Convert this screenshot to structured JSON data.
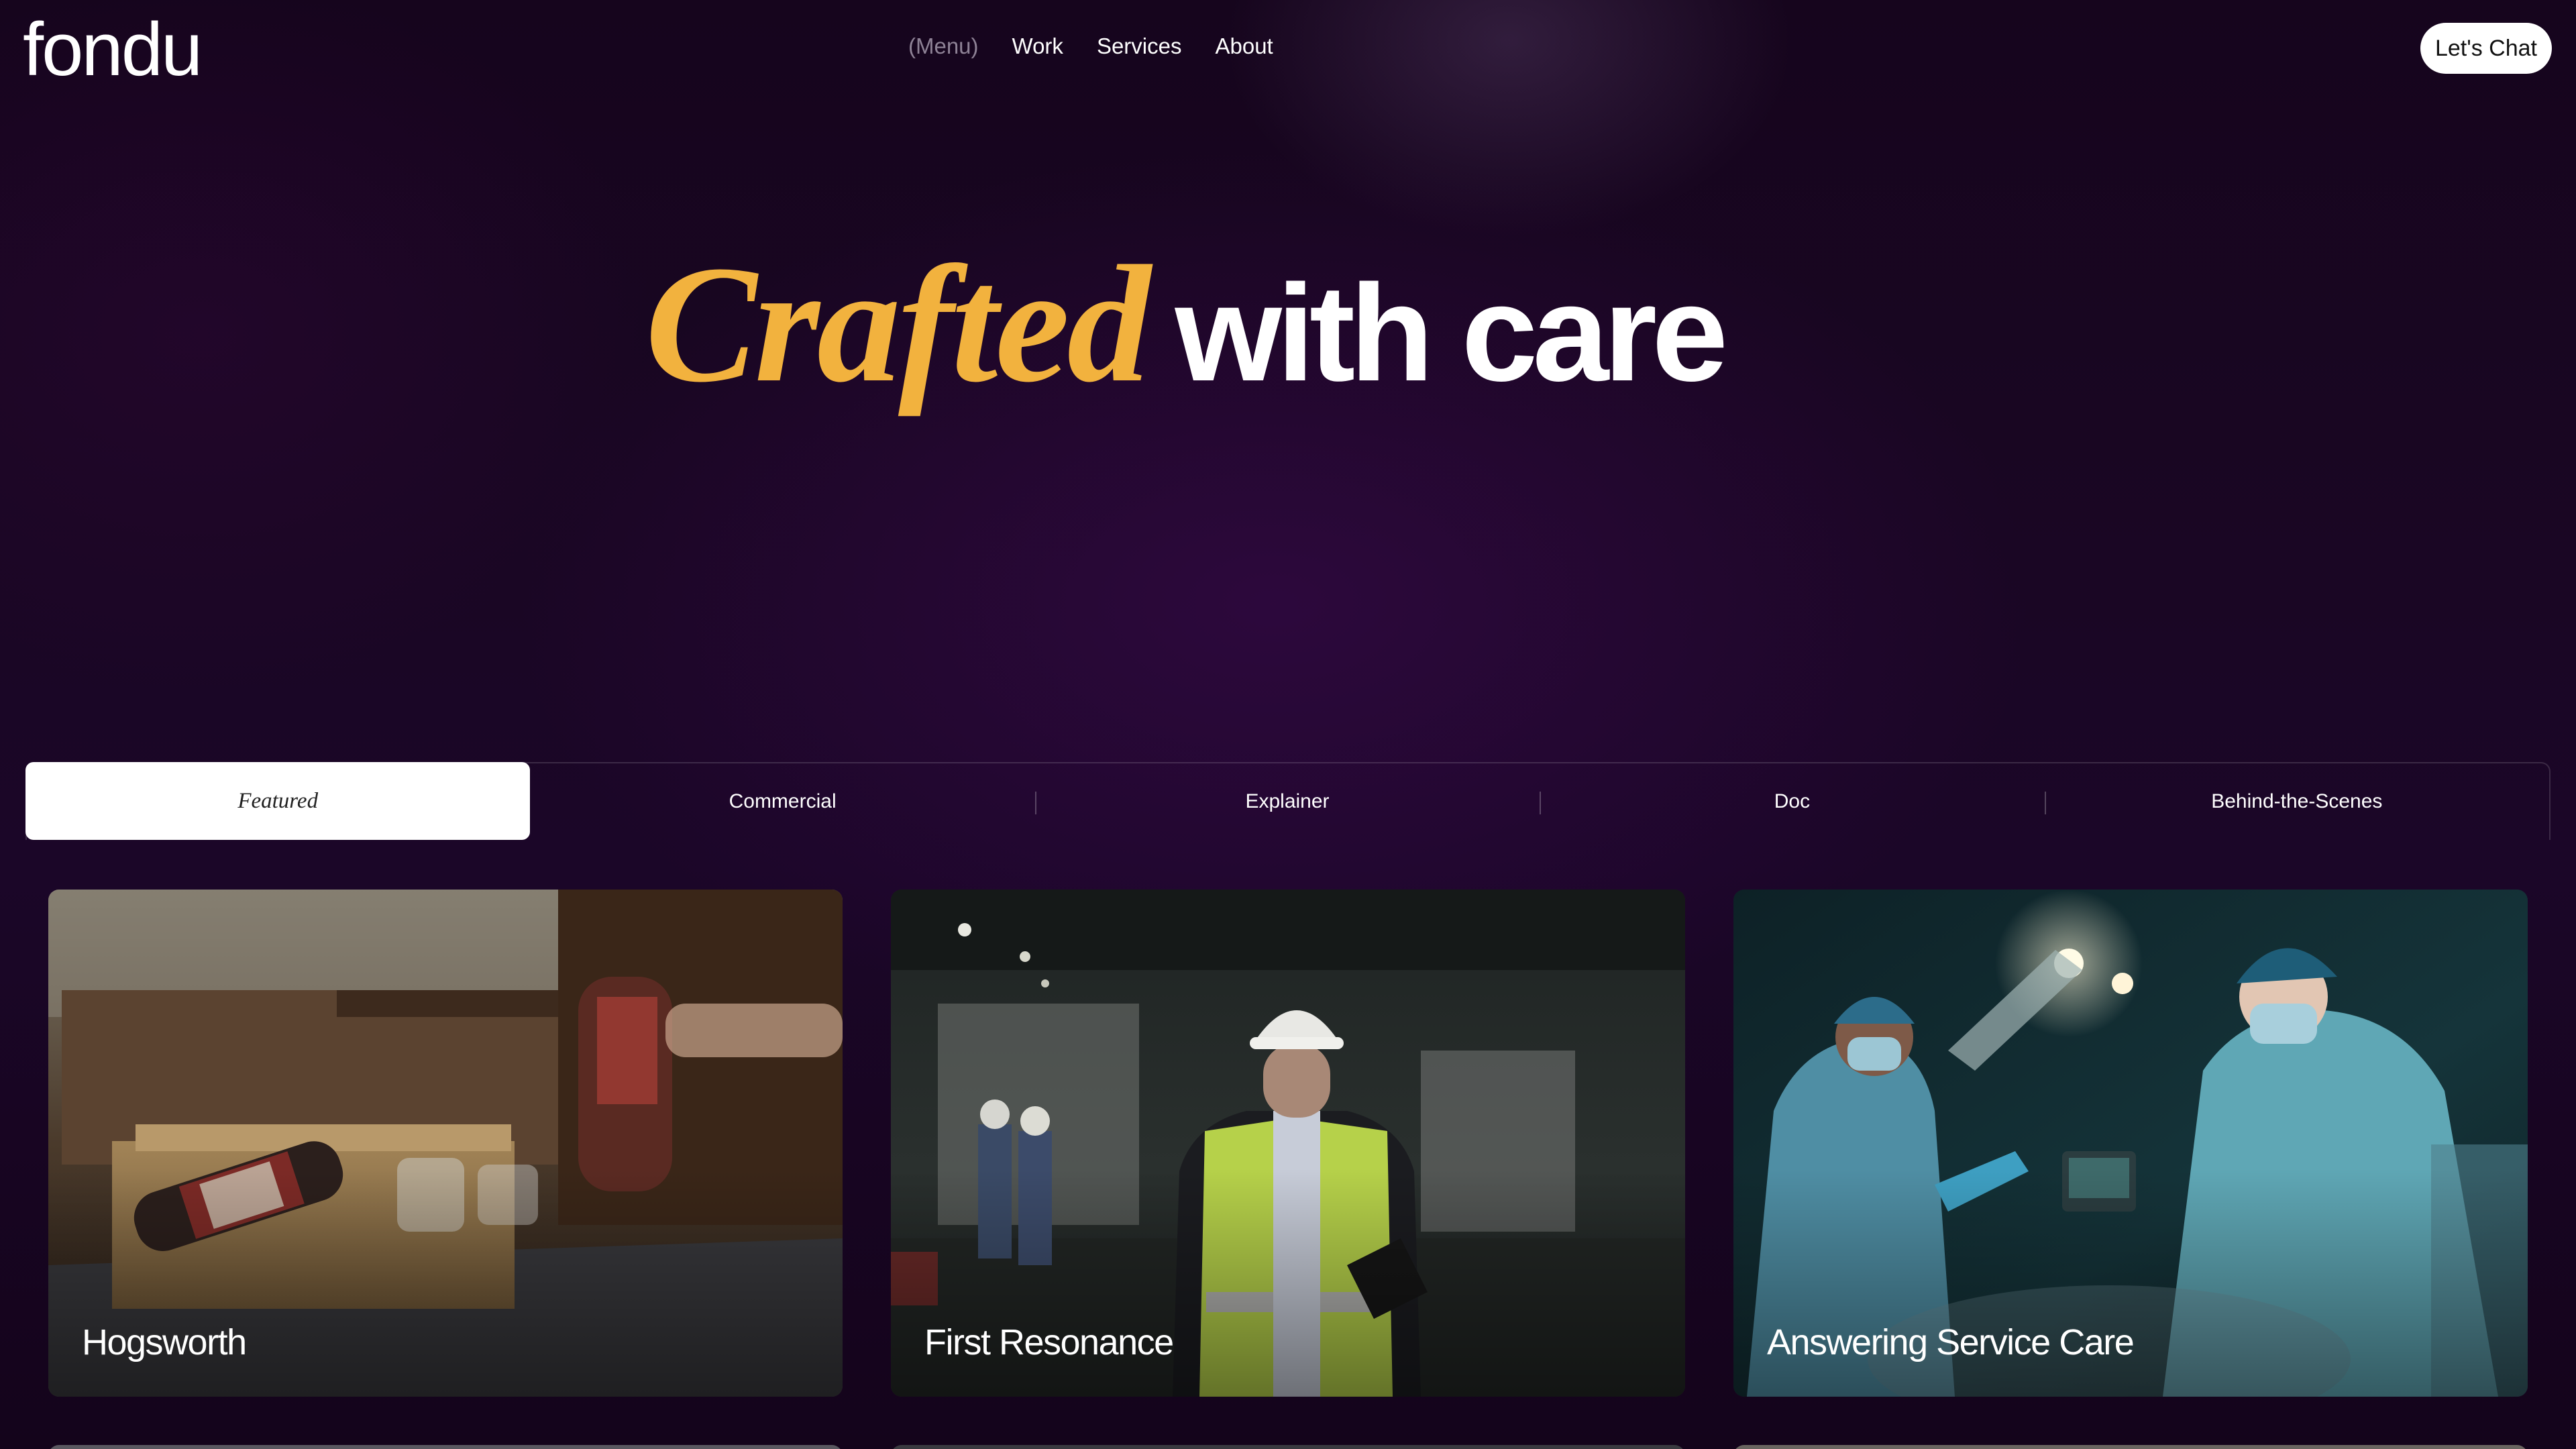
{
  "header": {
    "logo": "fondu",
    "nav": {
      "menu_label": "(Menu)",
      "links": [
        "Work",
        "Services",
        "About"
      ]
    },
    "cta_label": "Let's Chat"
  },
  "hero": {
    "accent_word": "Crafted",
    "rest": "with care"
  },
  "tabs": [
    {
      "label": "Featured",
      "active": true
    },
    {
      "label": "Commercial",
      "active": false
    },
    {
      "label": "Explainer",
      "active": false
    },
    {
      "label": "Doc",
      "active": false
    },
    {
      "label": "Behind-the-Scenes",
      "active": false
    }
  ],
  "cards": [
    {
      "title": "Hogsworth"
    },
    {
      "title": "First Resonance"
    },
    {
      "title": "Answering Service Care"
    }
  ],
  "colors": {
    "background": "#16051d",
    "accent": "#f2b23e",
    "text": "#ffffff"
  }
}
